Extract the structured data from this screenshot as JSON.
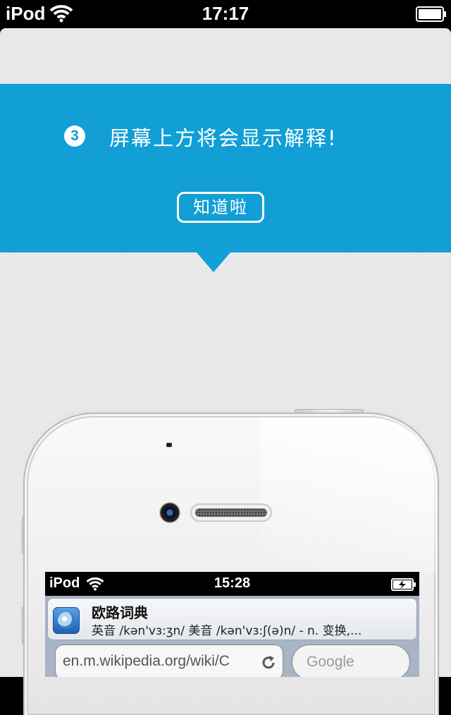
{
  "status_bar": {
    "carrier": "iPod",
    "time": "17:17"
  },
  "tip": {
    "step_number": "3",
    "text": "屏幕上方将会显示解释!",
    "ok_button": "知道啦",
    "banner_color": "#119fd5"
  },
  "phone": {
    "status_bar": {
      "carrier": "iPod",
      "time": "15:28"
    },
    "notification": {
      "app_name": "欧路词典",
      "body": "英音 /kən'vɜ:ʒn/   美音 /kən'vɜ:ʃ(ə)n/  - n. 变换,..."
    },
    "browser": {
      "url": "en.m.wikipedia.org/wiki/C",
      "search_placeholder": "Google"
    }
  }
}
